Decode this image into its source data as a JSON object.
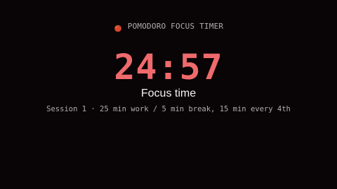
{
  "header": {
    "icon": "tomato-icon",
    "title": "POMODORO FOCUS TIMER"
  },
  "timer": {
    "display": "24:57"
  },
  "mode": {
    "label": "Focus time"
  },
  "session": {
    "info": "Session 1 · 25 min work / 5 min break, 15 min every 4th"
  },
  "colors": {
    "background": "#090406",
    "accent": "#ef6a6c",
    "muted_text": "#b2adb0",
    "primary_text": "#f4f2f3"
  }
}
